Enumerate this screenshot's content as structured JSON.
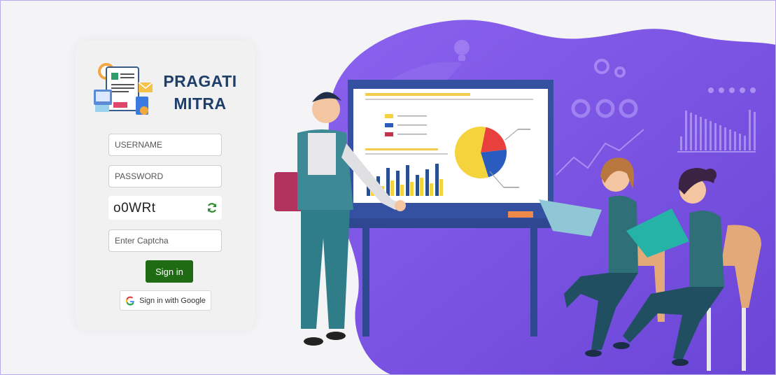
{
  "brand": {
    "line1": "PRAGATI",
    "line2": "MITRA"
  },
  "login": {
    "username_placeholder": "USERNAME",
    "password_placeholder": "PASSWORD",
    "captcha_code": "o0WRt",
    "captcha_placeholder": "Enter Captcha",
    "signin_label": "Sign in",
    "google_label": "Sign in with Google"
  },
  "colors": {
    "brand_text": "#1f3f6b",
    "signin_button": "#1f6b14",
    "refresh_icon": "#2e8b2e",
    "background_purple": "#7b55e6",
    "frame_border": "#b9a9ee"
  },
  "icons": [
    "document-logo-icon",
    "refresh-icon",
    "google-icon",
    "lightbulb-icon",
    "gears-icon",
    "stars-icon"
  ],
  "illustration": {
    "pie_slices": [
      {
        "value": 20,
        "color": "#e8403c"
      },
      {
        "value": 22,
        "color": "#2a5bbf"
      },
      {
        "value": 58,
        "color": "#f5d33c"
      }
    ],
    "bars": [
      [
        34,
        14
      ],
      [
        28,
        10
      ],
      [
        40,
        18
      ],
      [
        36,
        12
      ],
      [
        44,
        16
      ],
      [
        30,
        22
      ],
      [
        38,
        14
      ],
      [
        46,
        20
      ]
    ]
  }
}
